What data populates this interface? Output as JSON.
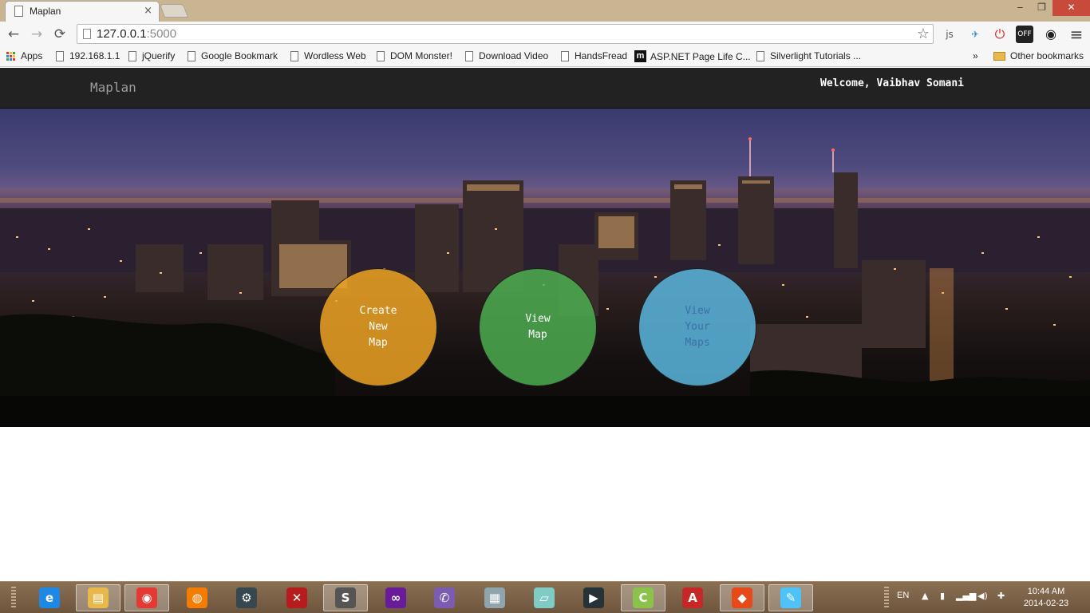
{
  "browser": {
    "tab_title": "Maplan",
    "tab_close": "×",
    "url": "127.0.0.1",
    "url_port": ":5000",
    "win_minimize": "‒",
    "win_restore": "❐",
    "win_close": "✕",
    "nav_back": "←",
    "nav_forward": "→",
    "nav_reload": "⟳",
    "star": "☆",
    "menu": "≡",
    "extensions": [
      "js",
      "✈",
      "⏻",
      "OFF",
      "◉"
    ]
  },
  "bookmarks": {
    "items": [
      {
        "label": "Apps",
        "icon": "apps-grid-icon"
      },
      {
        "label": "192.168.1.1",
        "icon": "page-icon"
      },
      {
        "label": "jQuerify",
        "icon": "page-icon"
      },
      {
        "label": "Google Bookmark",
        "icon": "page-icon"
      },
      {
        "label": "Wordless Web",
        "icon": "page-icon"
      },
      {
        "label": "DOM Monster!",
        "icon": "page-icon"
      },
      {
        "label": "Download Video",
        "icon": "page-icon"
      },
      {
        "label": "HandsFread",
        "icon": "page-icon"
      },
      {
        "label": "ASP.NET Page Life C...",
        "icon": "m-logo-icon"
      },
      {
        "label": "Silverlight Tutorials ...",
        "icon": "page-icon"
      }
    ],
    "overflow": "»",
    "other": "Other bookmarks",
    "m_logo_text": "m"
  },
  "page": {
    "brand": "Maplan",
    "welcome": "Welcome, Vaibhav Somani",
    "buttons": [
      {
        "label": "Create\nNew\nMap",
        "color": "#f0a523"
      },
      {
        "label": "View\nMap",
        "color": "#4caf50"
      },
      {
        "label": "View\nYour\nMaps",
        "color": "#5ab9e1"
      }
    ]
  },
  "taskbar": {
    "apps": [
      {
        "name": "internet-explorer",
        "glyph": "e",
        "color": "#1e88e5"
      },
      {
        "name": "file-explorer",
        "glyph": "▤",
        "color": "#e8b84a"
      },
      {
        "name": "chrome",
        "glyph": "◉",
        "color": "#e53935"
      },
      {
        "name": "firefox",
        "glyph": "◍",
        "color": "#f57c00"
      },
      {
        "name": "steam",
        "glyph": "⚙",
        "color": "#37474f"
      },
      {
        "name": "dota",
        "glyph": "✕",
        "color": "#b71c1c"
      },
      {
        "name": "sublime-text",
        "glyph": "S",
        "color": "#555555"
      },
      {
        "name": "visual-studio",
        "glyph": "∞",
        "color": "#6a1b9a"
      },
      {
        "name": "viber",
        "glyph": "✆",
        "color": "#7b5cb0"
      },
      {
        "name": "resource-monitor",
        "glyph": "▦",
        "color": "#90a4ae"
      },
      {
        "name": "notes",
        "glyph": "▱",
        "color": "#80cbc4"
      },
      {
        "name": "media-player",
        "glyph": "▶",
        "color": "#263238"
      },
      {
        "name": "codec-tool",
        "glyph": "C",
        "color": "#8bc34a"
      },
      {
        "name": "acrobat",
        "glyph": "A",
        "color": "#c62828"
      },
      {
        "name": "git",
        "glyph": "◆",
        "color": "#e64a19"
      },
      {
        "name": "paint",
        "glyph": "✎",
        "color": "#4fc3f7"
      }
    ],
    "lang": "EN",
    "tray_symbols": [
      "▲",
      "▮",
      "▂▄▆",
      "◀)",
      "✚"
    ],
    "time": "10:44 AM",
    "date": "2014-02-23"
  }
}
